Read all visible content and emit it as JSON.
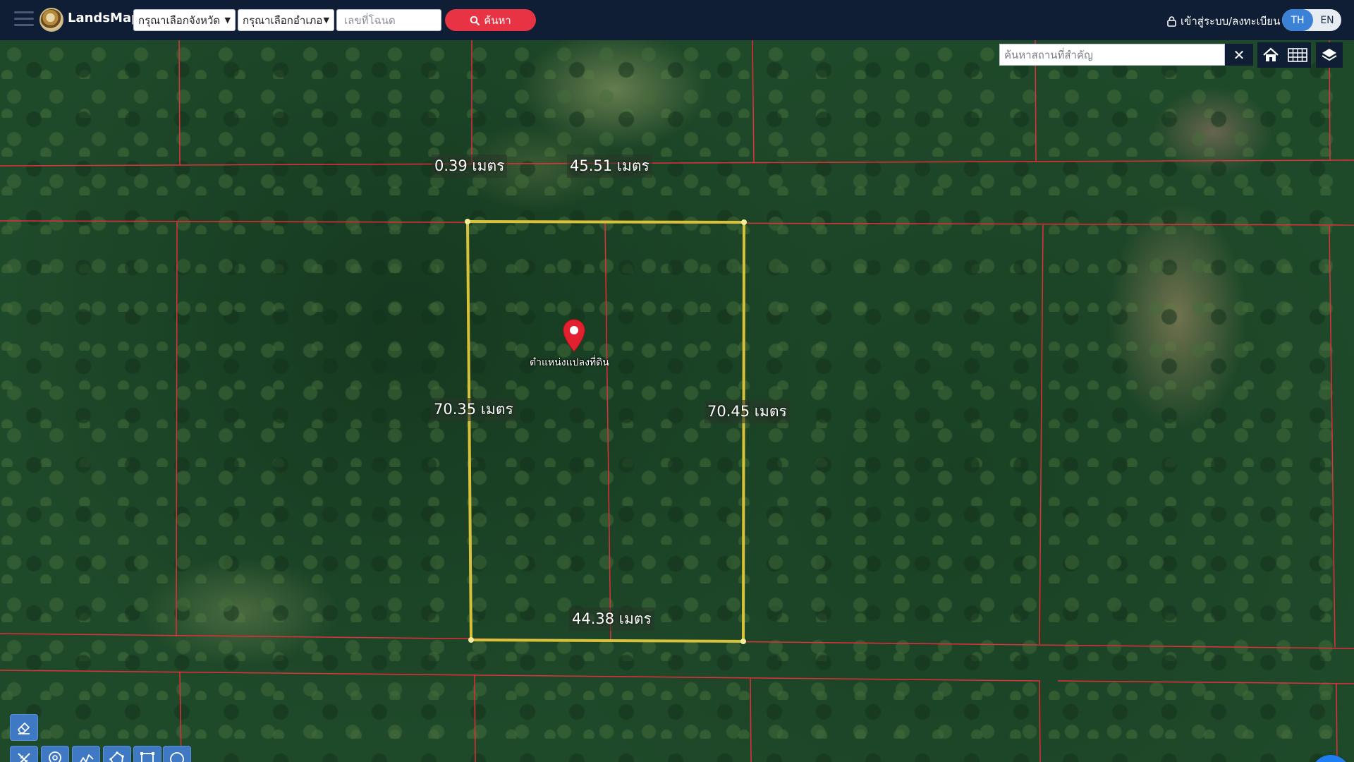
{
  "header": {
    "brand": "LandsMaps",
    "province_select": "กรุณาเลือกจังหวัด",
    "district_select": "กรุณาเลือกอำเภอ",
    "deed_placeholder": "เลขที่โฉนด",
    "search_label": "ค้นหา",
    "login_label": "เข้าสู่ระบบ/ลงทะเบียน",
    "lang_th": "TH",
    "lang_en": "EN"
  },
  "map": {
    "place_search_placeholder": "ค้นหาสถานที่สำคัญ",
    "clear_label": "✕",
    "marker_label": "ตำแหน่งแปลงที่ดิน",
    "measurements": {
      "top_left": "0.39 เมตร",
      "top": "45.51 เมตร",
      "left": "70.35 เมตร",
      "right": "70.45 เมตร",
      "bottom": "44.38 เมตร"
    }
  },
  "colors": {
    "topbar": "#0f1e35",
    "search_button": "#e83344",
    "parcel_outline": "#d9c23a",
    "boundary_lines": "#e0303a",
    "tool_button": "#3f79c4",
    "marker": "#e3202e"
  },
  "icons": {
    "menu": "hamburger-icon",
    "search": "magnifier-icon",
    "lock": "lock-icon",
    "home": "home-icon",
    "grid": "grid-icon",
    "layers": "layers-icon",
    "eraser": "eraser-icon",
    "measure": "ruler-cross-icon",
    "pin": "map-pin-icon",
    "line": "polyline-icon",
    "polygon": "polygon-icon",
    "rectangle": "rectangle-icon",
    "circle": "circle-icon",
    "more": "dots-icon"
  }
}
